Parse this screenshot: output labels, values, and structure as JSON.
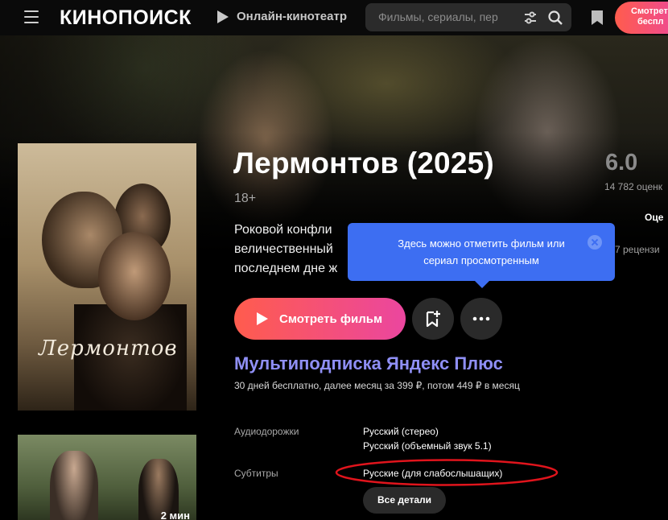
{
  "header": {
    "logo_text": "КИНОПОИСК",
    "online_label": "Онлайн-кинотеатр",
    "search_placeholder": "Фильмы, сериалы, пер",
    "watch_pill_line1": "Смотрет",
    "watch_pill_line2": "беспл"
  },
  "film": {
    "title": "Лермонтов (2025)",
    "age": "18+",
    "poster_title": "Лермонтов",
    "rating": "6.0",
    "rating_count": "14 782 оценк",
    "rate_label": "Оце",
    "reviews_label": "7 рецензи",
    "description_lines": [
      "Роковой конфли",
      "величественный",
      "последнем дне ж"
    ]
  },
  "tooltip": {
    "text_line1": "Здесь можно отметить фильм или",
    "text_line2": "сериал просмотренным"
  },
  "actions": {
    "watch_label": "Смотреть фильм"
  },
  "subscription": {
    "title": "Мультиподписка Яндекс Плюс",
    "note": "30 дней бесплатно, далее месяц за 399 ₽, потом 449 ₽ в месяц"
  },
  "details": {
    "audio_label": "Аудиодорожки",
    "audio_values": [
      "Русский (стерео)",
      "Русский (объемный звук 5.1)"
    ],
    "subs_label": "Субтитры",
    "subs_value": "Русские (для слабослышащих)",
    "all_details_label": "Все детали"
  },
  "trailer": {
    "duration": "2 мин"
  },
  "colors": {
    "accent_gradient_start": "#ff5c4d",
    "accent_gradient_end": "#eb469f",
    "subscription": "#8f8ff5",
    "tooltip": "#3d6ef2",
    "highlight_ellipse": "#e0141c"
  }
}
